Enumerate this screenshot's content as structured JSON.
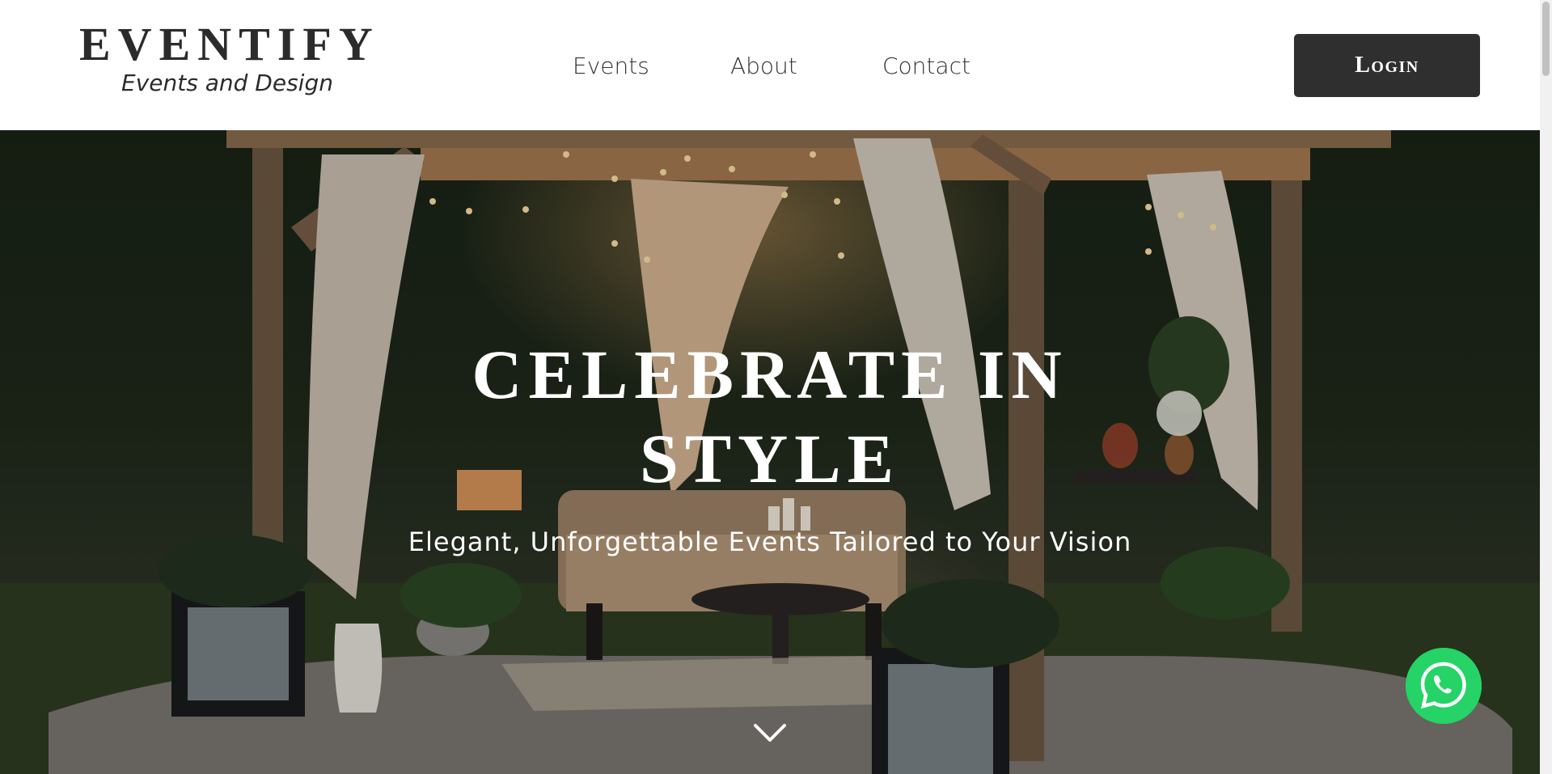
{
  "brand": {
    "title": "EVENTIFY",
    "tagline": "Events and Design"
  },
  "nav": {
    "items": [
      {
        "label": "Events"
      },
      {
        "label": "About"
      },
      {
        "label": "Contact"
      }
    ],
    "login_label": "Login"
  },
  "hero": {
    "title_line1": "CELEBRATE IN",
    "title_line2": "STYLE",
    "subtitle": "Elegant, Unforgettable Events Tailored to Your Vision"
  },
  "icons": {
    "scroll_down": "chevron-down-icon",
    "chat": "whatsapp-icon"
  },
  "colors": {
    "header_bg": "#ffffff",
    "brand_text": "#2b2b2b",
    "login_bg": "#2f2f2f",
    "hero_text": "#ffffff",
    "whatsapp": "#25d366"
  }
}
